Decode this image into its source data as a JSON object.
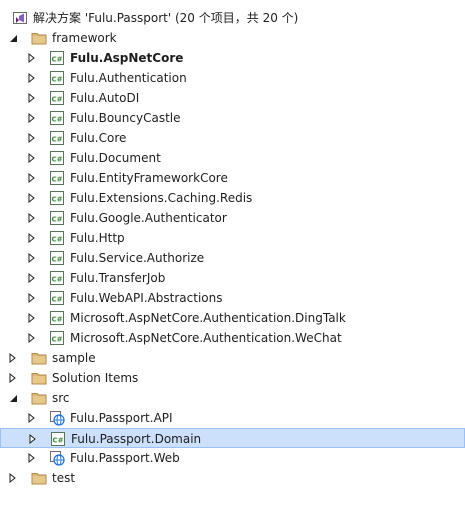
{
  "solution": {
    "label": "解决方案 'Fulu.Passport' (20 个项目，共 20 个)",
    "icon": "solution-icon"
  },
  "folders": {
    "framework": {
      "label": "framework",
      "icon": "folder-icon",
      "expanded": true
    },
    "sample": {
      "label": "sample",
      "icon": "folder-icon",
      "expanded": false
    },
    "solution_items": {
      "label": "Solution Items",
      "icon": "folder-icon",
      "expanded": false
    },
    "src": {
      "label": "src",
      "icon": "folder-icon",
      "expanded": true
    },
    "test": {
      "label": "test",
      "icon": "folder-icon",
      "expanded": false
    }
  },
  "framework_projects": [
    {
      "label": "Fulu.AspNetCore",
      "icon": "csharp-project-icon",
      "bold": true
    },
    {
      "label": "Fulu.Authentication",
      "icon": "csharp-project-icon"
    },
    {
      "label": "Fulu.AutoDI",
      "icon": "csharp-project-icon"
    },
    {
      "label": "Fulu.BouncyCastle",
      "icon": "csharp-project-icon"
    },
    {
      "label": "Fulu.Core",
      "icon": "csharp-project-icon"
    },
    {
      "label": "Fulu.Document",
      "icon": "csharp-project-icon"
    },
    {
      "label": "Fulu.EntityFrameworkCore",
      "icon": "csharp-project-icon"
    },
    {
      "label": "Fulu.Extensions.Caching.Redis",
      "icon": "csharp-project-icon"
    },
    {
      "label": "Fulu.Google.Authenticator",
      "icon": "csharp-project-icon"
    },
    {
      "label": "Fulu.Http",
      "icon": "csharp-project-icon"
    },
    {
      "label": "Fulu.Service.Authorize",
      "icon": "csharp-project-icon"
    },
    {
      "label": "Fulu.TransferJob",
      "icon": "csharp-project-icon"
    },
    {
      "label": "Fulu.WebAPI.Abstractions",
      "icon": "csharp-project-icon"
    },
    {
      "label": "Microsoft.AspNetCore.Authentication.DingTalk",
      "icon": "csharp-project-icon"
    },
    {
      "label": "Microsoft.AspNetCore.Authentication.WeChat",
      "icon": "csharp-project-icon"
    }
  ],
  "src_projects": [
    {
      "label": "Fulu.Passport.API",
      "icon": "web-project-icon"
    },
    {
      "label": "Fulu.Passport.Domain",
      "icon": "csharp-project-icon",
      "selected": true
    },
    {
      "label": "Fulu.Passport.Web",
      "icon": "web-project-icon"
    }
  ],
  "colors": {
    "selection_bg": "#cce0fc",
    "selection_border": "#99c1f7",
    "folder": "#dcb67a",
    "csharp_green": "#388a34",
    "web_blue": "#1e6fd9"
  }
}
